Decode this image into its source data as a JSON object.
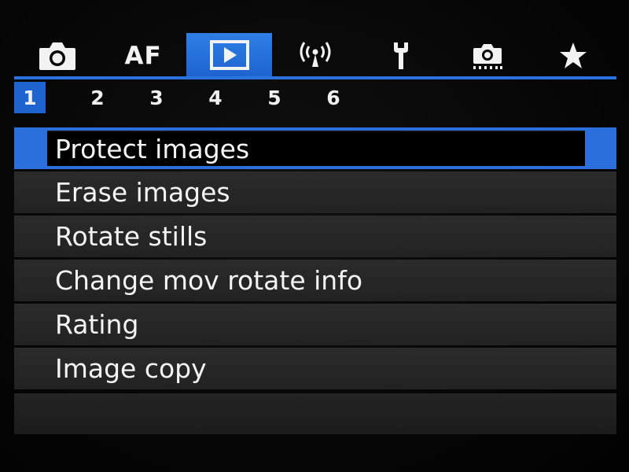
{
  "tabs": [
    {
      "icon": "camera-icon",
      "label": ""
    },
    {
      "icon": "",
      "label": "AF"
    },
    {
      "icon": "play-icon",
      "label": "",
      "selected": true
    },
    {
      "icon": "wireless-icon",
      "label": ""
    },
    {
      "icon": "wrench-icon",
      "label": ""
    },
    {
      "icon": "custom-camera-icon",
      "label": ""
    },
    {
      "icon": "star-icon",
      "label": ""
    }
  ],
  "pages": [
    "1",
    "2",
    "3",
    "4",
    "5",
    "6"
  ],
  "selected_page": "1",
  "menu": {
    "items": [
      "Protect images",
      "Erase images",
      "Rotate stills",
      "Change mov rotate info",
      "Rating",
      "Image copy"
    ],
    "selected_index": 0
  },
  "colors": {
    "accent": "#2a6fdc",
    "row_background": "#262626",
    "text": "#f4f4f4"
  }
}
